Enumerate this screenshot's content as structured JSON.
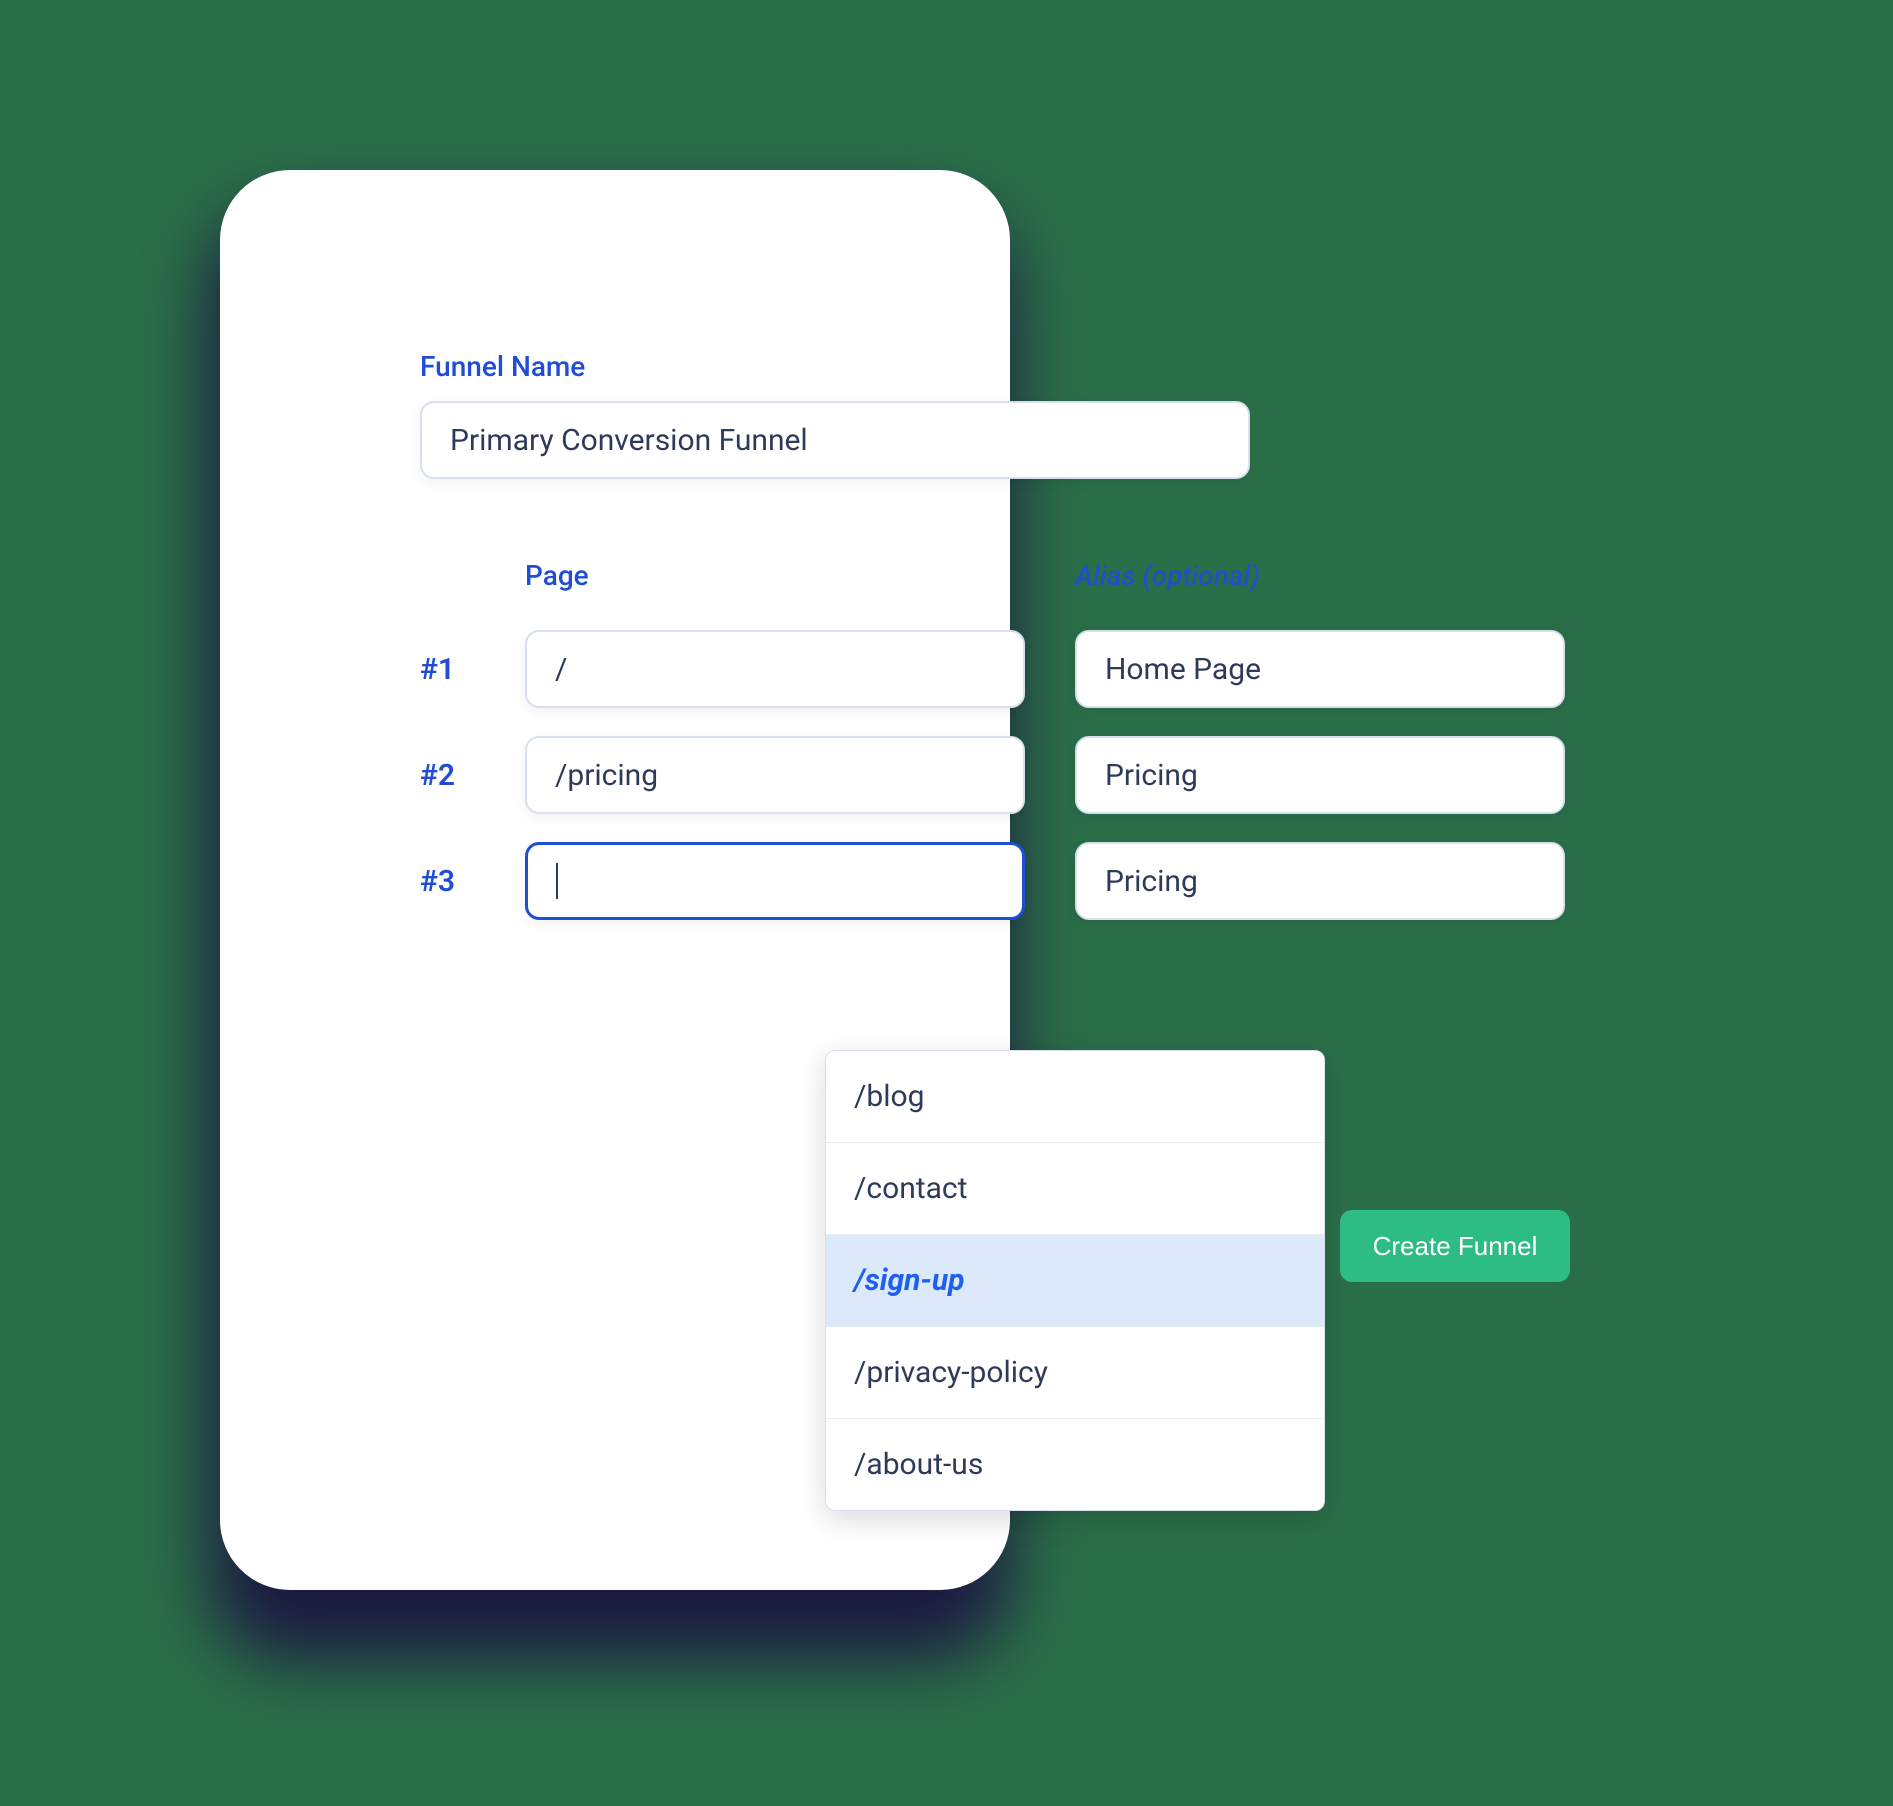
{
  "funnel": {
    "name_label": "Funnel Name",
    "name_value": "Primary Conversion Funnel"
  },
  "columns": {
    "page_label": "Page",
    "alias_label": "Alias (optional)"
  },
  "steps": [
    {
      "number": "#1",
      "page": "/",
      "alias": "Home Page"
    },
    {
      "number": "#2",
      "page": "/pricing",
      "alias": "Pricing"
    },
    {
      "number": "#3",
      "page": "",
      "alias": "Pricing"
    }
  ],
  "dropdown": {
    "options": [
      {
        "label": "/blog",
        "highlighted": false
      },
      {
        "label": "/contact",
        "highlighted": false
      },
      {
        "label": "/sign-up",
        "highlighted": true
      },
      {
        "label": "/privacy-policy",
        "highlighted": false
      },
      {
        "label": "/about-us",
        "highlighted": false
      }
    ]
  },
  "actions": {
    "create_label": "Create Funnel"
  },
  "colors": {
    "background": "#2a6e48",
    "primary_blue": "#1f4dd6",
    "button_green": "#2ebc85",
    "text": "#2e3a59",
    "highlight_bg": "#dce9fa"
  }
}
